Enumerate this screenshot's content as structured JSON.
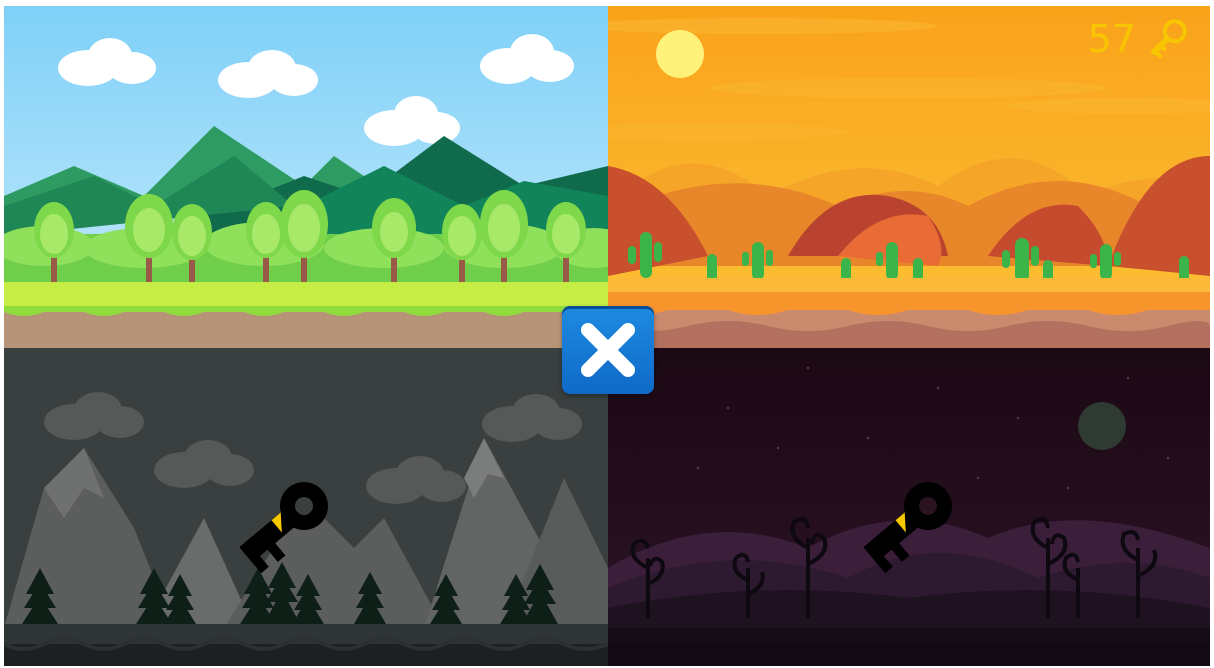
{
  "hud": {
    "key_count": "57",
    "key_icon": "key-icon",
    "key_color": "#f7c600"
  },
  "close_button": {
    "icon": "close-icon",
    "color": "#1278d6"
  },
  "worlds": [
    {
      "id": "forest",
      "name": "",
      "locked": false
    },
    {
      "id": "desert",
      "name": "",
      "locked": false
    },
    {
      "id": "mountains",
      "name": "",
      "locked": true,
      "lock_icon": "key-icon"
    },
    {
      "id": "night",
      "name": "",
      "locked": true,
      "lock_icon": "key-icon"
    }
  ]
}
